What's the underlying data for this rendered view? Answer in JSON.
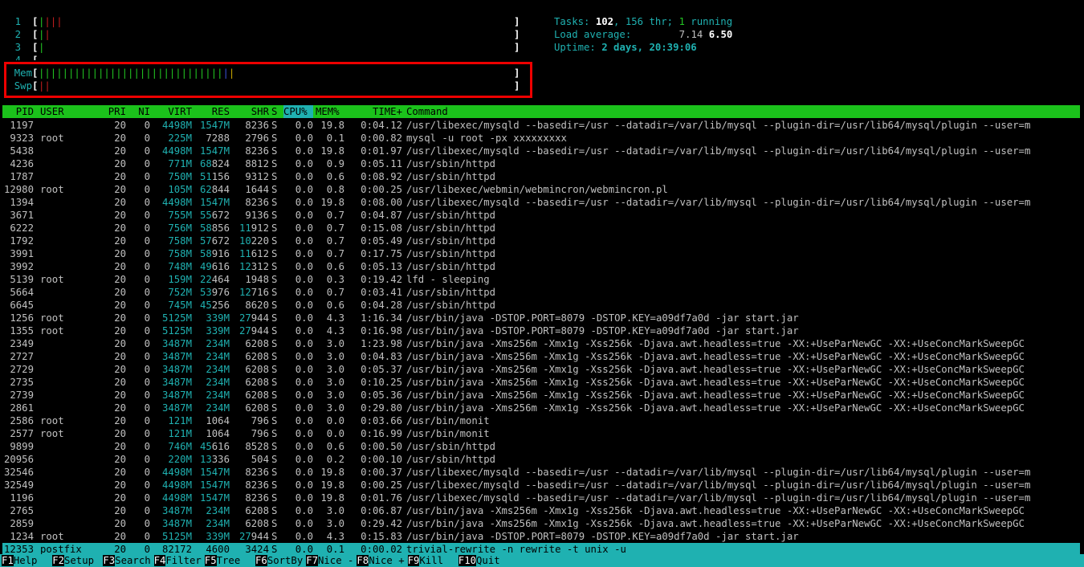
{
  "cpu_meters": [
    {
      "label": "1",
      "segments": [
        {
          "text": "|",
          "color": "green"
        },
        {
          "text": "|",
          "color": "red"
        },
        {
          "text": "|",
          "color": "red"
        },
        {
          "text": "|",
          "color": "red"
        }
      ]
    },
    {
      "label": "2",
      "segments": [
        {
          "text": "|",
          "color": "green"
        },
        {
          "text": "|",
          "color": "red"
        }
      ]
    },
    {
      "label": "3",
      "segments": [
        {
          "text": "|",
          "color": "green"
        }
      ]
    },
    {
      "label": "4",
      "segments": []
    }
  ],
  "mem_meter": {
    "label": "Mem",
    "segments": [
      {
        "text": "|||||||||||||||||||||||||||||||",
        "color": "green"
      },
      {
        "text": "|",
        "color": "blue"
      },
      {
        "text": "|",
        "color": "yellow"
      }
    ]
  },
  "swp_meter": {
    "label": "Swp",
    "segments": [
      {
        "text": "||",
        "color": "red"
      }
    ]
  },
  "bracket_open": "[",
  "bracket_close": "]",
  "summary": {
    "tasks_label": "Tasks: ",
    "tasks": "102",
    "threads": ", 156 thr; ",
    "running": "1",
    "running_label": " running",
    "load_label": "Load average: ",
    "load_1": "7.14",
    "load_5": "6.50",
    "uptime_label": "Uptime: ",
    "uptime": "2 days, 20:39:06"
  },
  "columns": {
    "pid": "PID",
    "user": "USER",
    "pri": "PRI",
    "ni": "NI",
    "virt": "VIRT",
    "res": "RES",
    "shr": "SHR",
    "s": "S",
    "cpu": "CPU%",
    "mem": "MEM%",
    "time": "TIME+",
    "cmd": "Command"
  },
  "processes": [
    {
      "pid": "1197",
      "user": "",
      "pri": "20",
      "ni": "0",
      "virt": "4498M",
      "res": "1547M",
      "shr": "8236",
      "s": "S",
      "cpu": "0.0",
      "mem": "19.8",
      "time": "0:04.12",
      "cmd": "/usr/libexec/mysqld --basedir=/usr --datadir=/var/lib/mysql --plugin-dir=/usr/lib64/mysql/plugin --user=m"
    },
    {
      "pid": "9323",
      "user": "root",
      "pri": "20",
      "ni": "0",
      "virt": "225M",
      "res": "7288",
      "shr": "2796",
      "s": "S",
      "cpu": "0.0",
      "mem": "0.1",
      "time": "0:00.82",
      "cmd": "mysql -u root -px xxxxxxxxx"
    },
    {
      "pid": "5438",
      "user": "",
      "pri": "20",
      "ni": "0",
      "virt": "4498M",
      "res": "1547M",
      "shr": "8236",
      "s": "S",
      "cpu": "0.0",
      "mem": "19.8",
      "time": "0:01.97",
      "cmd": "/usr/libexec/mysqld --basedir=/usr --datadir=/var/lib/mysql --plugin-dir=/usr/lib64/mysql/plugin --user=m"
    },
    {
      "pid": "4236",
      "user": "",
      "pri": "20",
      "ni": "0",
      "virt": "771M",
      "res": "68824",
      "shr": "8812",
      "s": "S",
      "cpu": "0.0",
      "mem": "0.9",
      "time": "0:05.11",
      "cmd": "/usr/sbin/httpd"
    },
    {
      "pid": "1787",
      "user": "",
      "pri": "20",
      "ni": "0",
      "virt": "750M",
      "res": "51156",
      "shr": "9312",
      "s": "S",
      "cpu": "0.0",
      "mem": "0.6",
      "time": "0:08.92",
      "cmd": "/usr/sbin/httpd"
    },
    {
      "pid": "12980",
      "user": "root",
      "pri": "20",
      "ni": "0",
      "virt": "105M",
      "res": "62844",
      "shr": "1644",
      "s": "S",
      "cpu": "0.0",
      "mem": "0.8",
      "time": "0:00.25",
      "cmd": "/usr/libexec/webmin/webmincron/webmincron.pl"
    },
    {
      "pid": "1394",
      "user": "",
      "pri": "20",
      "ni": "0",
      "virt": "4498M",
      "res": "1547M",
      "shr": "8236",
      "s": "S",
      "cpu": "0.0",
      "mem": "19.8",
      "time": "0:08.00",
      "cmd": "/usr/libexec/mysqld --basedir=/usr --datadir=/var/lib/mysql --plugin-dir=/usr/lib64/mysql/plugin --user=m"
    },
    {
      "pid": "3671",
      "user": "",
      "pri": "20",
      "ni": "0",
      "virt": "755M",
      "res": "55672",
      "shr": "9136",
      "s": "S",
      "cpu": "0.0",
      "mem": "0.7",
      "time": "0:04.87",
      "cmd": "/usr/sbin/httpd"
    },
    {
      "pid": "6222",
      "user": "",
      "pri": "20",
      "ni": "0",
      "virt": "756M",
      "res": "58856",
      "shr": "11912",
      "s": "S",
      "cpu": "0.0",
      "mem": "0.7",
      "time": "0:15.08",
      "cmd": "/usr/sbin/httpd"
    },
    {
      "pid": "1792",
      "user": "",
      "pri": "20",
      "ni": "0",
      "virt": "758M",
      "res": "57672",
      "shr": "10220",
      "s": "S",
      "cpu": "0.0",
      "mem": "0.7",
      "time": "0:05.49",
      "cmd": "/usr/sbin/httpd"
    },
    {
      "pid": "3991",
      "user": "",
      "pri": "20",
      "ni": "0",
      "virt": "758M",
      "res": "58916",
      "shr": "11612",
      "s": "S",
      "cpu": "0.0",
      "mem": "0.7",
      "time": "0:17.75",
      "cmd": "/usr/sbin/httpd"
    },
    {
      "pid": "3992",
      "user": "",
      "pri": "20",
      "ni": "0",
      "virt": "748M",
      "res": "49616",
      "shr": "12312",
      "s": "S",
      "cpu": "0.0",
      "mem": "0.6",
      "time": "0:05.13",
      "cmd": "/usr/sbin/httpd"
    },
    {
      "pid": "5139",
      "user": "root",
      "pri": "20",
      "ni": "0",
      "virt": "159M",
      "res": "22464",
      "shr": "1948",
      "s": "S",
      "cpu": "0.0",
      "mem": "0.3",
      "time": "0:19.42",
      "cmd": "lfd - sleeping"
    },
    {
      "pid": "5664",
      "user": "",
      "pri": "20",
      "ni": "0",
      "virt": "752M",
      "res": "53976",
      "shr": "12716",
      "s": "S",
      "cpu": "0.0",
      "mem": "0.7",
      "time": "0:03.41",
      "cmd": "/usr/sbin/httpd"
    },
    {
      "pid": "6645",
      "user": "",
      "pri": "20",
      "ni": "0",
      "virt": "745M",
      "res": "45256",
      "shr": "8620",
      "s": "S",
      "cpu": "0.0",
      "mem": "0.6",
      "time": "0:04.28",
      "cmd": "/usr/sbin/httpd"
    },
    {
      "pid": "1256",
      "user": "root",
      "pri": "20",
      "ni": "0",
      "virt": "5125M",
      "res": "339M",
      "shr": "27944",
      "s": "S",
      "cpu": "0.0",
      "mem": "4.3",
      "time": "1:16.34",
      "cmd": "/usr/bin/java -DSTOP.PORT=8079 -DSTOP.KEY=a09df7a0d -jar start.jar"
    },
    {
      "pid": "1355",
      "user": "root",
      "pri": "20",
      "ni": "0",
      "virt": "5125M",
      "res": "339M",
      "shr": "27944",
      "s": "S",
      "cpu": "0.0",
      "mem": "4.3",
      "time": "0:16.98",
      "cmd": "/usr/bin/java -DSTOP.PORT=8079 -DSTOP.KEY=a09df7a0d -jar start.jar"
    },
    {
      "pid": "2349",
      "user": "",
      "pri": "20",
      "ni": "0",
      "virt": "3487M",
      "res": "234M",
      "shr": "6208",
      "s": "S",
      "cpu": "0.0",
      "mem": "3.0",
      "time": "1:23.98",
      "cmd": "/usr/bin/java -Xms256m -Xmx1g -Xss256k -Djava.awt.headless=true -XX:+UseParNewGC -XX:+UseConcMarkSweepGC"
    },
    {
      "pid": "2727",
      "user": "",
      "pri": "20",
      "ni": "0",
      "virt": "3487M",
      "res": "234M",
      "shr": "6208",
      "s": "S",
      "cpu": "0.0",
      "mem": "3.0",
      "time": "0:04.83",
      "cmd": "/usr/bin/java -Xms256m -Xmx1g -Xss256k -Djava.awt.headless=true -XX:+UseParNewGC -XX:+UseConcMarkSweepGC"
    },
    {
      "pid": "2729",
      "user": "",
      "pri": "20",
      "ni": "0",
      "virt": "3487M",
      "res": "234M",
      "shr": "6208",
      "s": "S",
      "cpu": "0.0",
      "mem": "3.0",
      "time": "0:05.37",
      "cmd": "/usr/bin/java -Xms256m -Xmx1g -Xss256k -Djava.awt.headless=true -XX:+UseParNewGC -XX:+UseConcMarkSweepGC"
    },
    {
      "pid": "2735",
      "user": "",
      "pri": "20",
      "ni": "0",
      "virt": "3487M",
      "res": "234M",
      "shr": "6208",
      "s": "S",
      "cpu": "0.0",
      "mem": "3.0",
      "time": "0:10.25",
      "cmd": "/usr/bin/java -Xms256m -Xmx1g -Xss256k -Djava.awt.headless=true -XX:+UseParNewGC -XX:+UseConcMarkSweepGC"
    },
    {
      "pid": "2739",
      "user": "",
      "pri": "20",
      "ni": "0",
      "virt": "3487M",
      "res": "234M",
      "shr": "6208",
      "s": "S",
      "cpu": "0.0",
      "mem": "3.0",
      "time": "0:05.36",
      "cmd": "/usr/bin/java -Xms256m -Xmx1g -Xss256k -Djava.awt.headless=true -XX:+UseParNewGC -XX:+UseConcMarkSweepGC"
    },
    {
      "pid": "2861",
      "user": "",
      "pri": "20",
      "ni": "0",
      "virt": "3487M",
      "res": "234M",
      "shr": "6208",
      "s": "S",
      "cpu": "0.0",
      "mem": "3.0",
      "time": "0:29.80",
      "cmd": "/usr/bin/java -Xms256m -Xmx1g -Xss256k -Djava.awt.headless=true -XX:+UseParNewGC -XX:+UseConcMarkSweepGC"
    },
    {
      "pid": "2586",
      "user": "root",
      "pri": "20",
      "ni": "0",
      "virt": "121M",
      "res": "1064",
      "shr": "796",
      "s": "S",
      "cpu": "0.0",
      "mem": "0.0",
      "time": "0:03.66",
      "cmd": "/usr/bin/monit"
    },
    {
      "pid": "2577",
      "user": "root",
      "pri": "20",
      "ni": "0",
      "virt": "121M",
      "res": "1064",
      "shr": "796",
      "s": "S",
      "cpu": "0.0",
      "mem": "0.0",
      "time": "0:16.99",
      "cmd": "/usr/bin/monit"
    },
    {
      "pid": "9899",
      "user": "",
      "pri": "20",
      "ni": "0",
      "virt": "746M",
      "res": "45616",
      "shr": "8528",
      "s": "S",
      "cpu": "0.0",
      "mem": "0.6",
      "time": "0:00.50",
      "cmd": "/usr/sbin/httpd"
    },
    {
      "pid": "20956",
      "user": "",
      "pri": "20",
      "ni": "0",
      "virt": "220M",
      "res": "13336",
      "shr": "504",
      "s": "S",
      "cpu": "0.0",
      "mem": "0.2",
      "time": "0:00.10",
      "cmd": "/usr/sbin/httpd"
    },
    {
      "pid": "32546",
      "user": "",
      "pri": "20",
      "ni": "0",
      "virt": "4498M",
      "res": "1547M",
      "shr": "8236",
      "s": "S",
      "cpu": "0.0",
      "mem": "19.8",
      "time": "0:00.37",
      "cmd": "/usr/libexec/mysqld --basedir=/usr --datadir=/var/lib/mysql --plugin-dir=/usr/lib64/mysql/plugin --user=m"
    },
    {
      "pid": "32549",
      "user": "",
      "pri": "20",
      "ni": "0",
      "virt": "4498M",
      "res": "1547M",
      "shr": "8236",
      "s": "S",
      "cpu": "0.0",
      "mem": "19.8",
      "time": "0:00.25",
      "cmd": "/usr/libexec/mysqld --basedir=/usr --datadir=/var/lib/mysql --plugin-dir=/usr/lib64/mysql/plugin --user=m"
    },
    {
      "pid": "1196",
      "user": "",
      "pri": "20",
      "ni": "0",
      "virt": "4498M",
      "res": "1547M",
      "shr": "8236",
      "s": "S",
      "cpu": "0.0",
      "mem": "19.8",
      "time": "0:01.76",
      "cmd": "/usr/libexec/mysqld --basedir=/usr --datadir=/var/lib/mysql --plugin-dir=/usr/lib64/mysql/plugin --user=m"
    },
    {
      "pid": "2765",
      "user": "",
      "pri": "20",
      "ni": "0",
      "virt": "3487M",
      "res": "234M",
      "shr": "6208",
      "s": "S",
      "cpu": "0.0",
      "mem": "3.0",
      "time": "0:06.87",
      "cmd": "/usr/bin/java -Xms256m -Xmx1g -Xss256k -Djava.awt.headless=true -XX:+UseParNewGC -XX:+UseConcMarkSweepGC"
    },
    {
      "pid": "2859",
      "user": "",
      "pri": "20",
      "ni": "0",
      "virt": "3487M",
      "res": "234M",
      "shr": "6208",
      "s": "S",
      "cpu": "0.0",
      "mem": "3.0",
      "time": "0:29.42",
      "cmd": "/usr/bin/java -Xms256m -Xmx1g -Xss256k -Djava.awt.headless=true -XX:+UseParNewGC -XX:+UseConcMarkSweepGC"
    },
    {
      "pid": "1234",
      "user": "root",
      "pri": "20",
      "ni": "0",
      "virt": "5125M",
      "res": "339M",
      "shr": "27944",
      "s": "S",
      "cpu": "0.0",
      "mem": "4.3",
      "time": "0:15.83",
      "cmd": "/usr/bin/java -DSTOP.PORT=8079 -DSTOP.KEY=a09df7a0d -jar start.jar"
    },
    {
      "pid": "12353",
      "user": "postfix",
      "pri": "20",
      "ni": "0",
      "virt": "82172",
      "res": "4600",
      "shr": "3424",
      "s": "S",
      "cpu": "0.0",
      "mem": "0.1",
      "time": "0:00.02",
      "cmd": "trivial-rewrite -n rewrite -t unix -u",
      "selected": true
    }
  ],
  "footer": [
    {
      "key": "F1",
      "label": "Help  "
    },
    {
      "key": "F2",
      "label": "Setup "
    },
    {
      "key": "F3",
      "label": "Search"
    },
    {
      "key": "F4",
      "label": "Filter"
    },
    {
      "key": "F5",
      "label": "Tree  "
    },
    {
      "key": "F6",
      "label": "SortBy"
    },
    {
      "key": "F7",
      "label": "Nice -"
    },
    {
      "key": "F8",
      "label": "Nice +"
    },
    {
      "key": "F9",
      "label": "Kill  "
    },
    {
      "key": "F10",
      "label": "Quit"
    }
  ],
  "colors": {
    "green": "#22c522",
    "cyan": "#1fb1b1",
    "red": "#c51e1e",
    "highlight_box": "#e00000"
  }
}
